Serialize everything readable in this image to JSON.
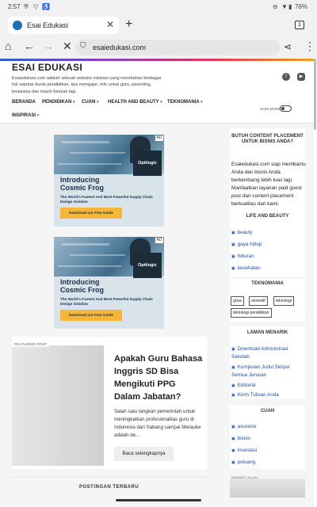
{
  "status_bar": {
    "time": "2:57",
    "battery": "76%"
  },
  "tab": {
    "title": "Esai Edukasi",
    "count": "1"
  },
  "toolbar": {
    "url": "esaiedukasi.com"
  },
  "site": {
    "title": "ESAI EDUKASI",
    "description": "Esaiedukasi.com adalah sebuah website edukasi yang membahas berbagai hal seputar dunia pendidikan, tips mengajar, info untuk guru, parenting, beasiswa dan masih banyak lagi."
  },
  "nav": {
    "items": [
      "BERANDA",
      "PENDIDIKAN",
      "CUAN",
      "HEALTH AND BEAUTY",
      "TEKNOMANIA",
      "INSPIRASI"
    ],
    "dark_mode_label": "DARK MODE"
  },
  "ad": {
    "badge": "AD",
    "logo": "Optilogic",
    "headline_1": "Introducing",
    "headline_2": "Cosmic Frog",
    "sub": "The World's Fastest And Most Powerful Supply Chain Design Solution",
    "cta": "Download our Free Guide"
  },
  "featured": {
    "badge": "FEATURED POST",
    "title": "Apakah Guru Bahasa Inggris SD Bisa Mengikuti PPG Dalam Jabatan?",
    "excerpt": "Salah satu langkah pemerintah untuk meningkatkan profesionalitas guru di Indonesia dari Sabang sampai Merauke adalah de...",
    "more": "Baca selengkapnya"
  },
  "recent_heading": "POSTINGAN TERBARU",
  "sidebar": {
    "promo_title": "BUTUH CONTENT PLACEMENT UNTUK BISNIS ANDA?",
    "promo_text": "Esaiedukasi.com siap membantu Anda dan bisnis Anda berkembang lebih luas lagi. Manfaatkan layanan paid guest post dan content placement berkualitas dari kami.",
    "life_title": "LIFE AND BEAUTY",
    "life_items": [
      "beauty",
      "gaya hidup",
      "hiburan",
      "kesehatan"
    ],
    "tekno_title": "TEKNOMANIA",
    "tekno_tags": [
      "griya",
      "otomotif",
      "teknologi",
      "teknologi pendidikan"
    ],
    "menarik_title": "LAMAN MENARIK",
    "menarik_items": [
      "Download Administrasi Sekolah",
      "Kumpulan Judul Skripsi Semua Jurusan",
      "Editorial",
      "Kirim Tulisan Anda"
    ],
    "cuan_title": "CUAN",
    "cuan_items": [
      "asuransi",
      "bisnis",
      "investasi",
      "peluang"
    ],
    "banner_label": "BANNER IKLAN"
  }
}
